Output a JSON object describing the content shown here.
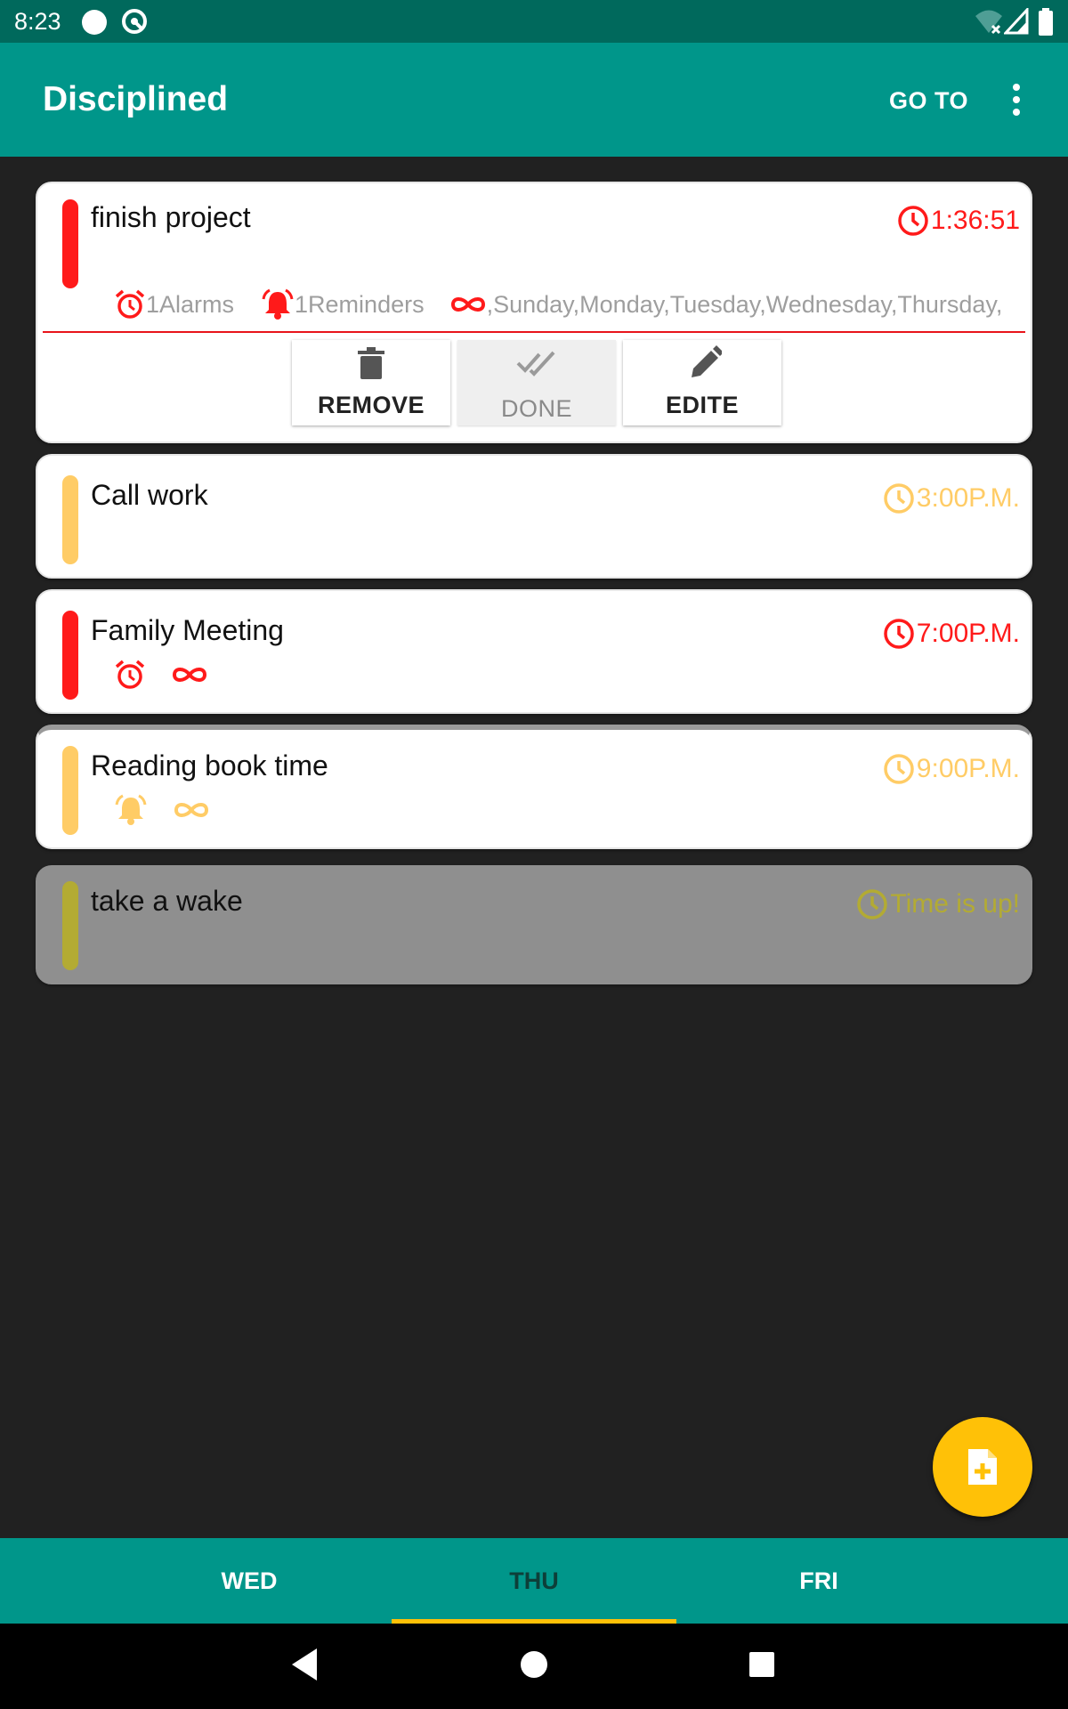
{
  "status_bar": {
    "time": "8:23"
  },
  "app_bar": {
    "title": "Disciplined",
    "goto_label": "GO TO"
  },
  "tasks": [
    {
      "title": "finish project",
      "time": "1:36:51",
      "accent_color": "#ff1a1a",
      "alarms_label": "1Alarms",
      "reminders_label": "1Reminders",
      "repeat_label": ",Sunday,Monday,Tuesday,Wednesday,Thursday,",
      "actions": {
        "remove": "REMOVE",
        "done": "DONE",
        "edit": "EDITE"
      }
    },
    {
      "title": "Call work",
      "time": "3:00P.M.",
      "accent_color": "#ffcc66"
    },
    {
      "title": "Family Meeting",
      "time": "7:00P.M.",
      "accent_color": "#ff1a1a",
      "icons": [
        "alarm-icon",
        "repeat-icon"
      ]
    },
    {
      "title": "Reading book time",
      "time": "9:00P.M.",
      "accent_color": "#ffcc66",
      "icons": [
        "bell-icon",
        "repeat-icon"
      ]
    },
    {
      "title": "take a wake",
      "time": "Time is up!",
      "accent_color": "#b3ab33"
    }
  ],
  "tabs": [
    {
      "label": "WED"
    },
    {
      "label": "THU"
    },
    {
      "label": "FRI"
    }
  ],
  "colors": {
    "primary": "#00968a",
    "primary_dark": "#00695c",
    "accent": "#ffc107",
    "red": "#ff1a1a",
    "yellow": "#ffcc66"
  }
}
